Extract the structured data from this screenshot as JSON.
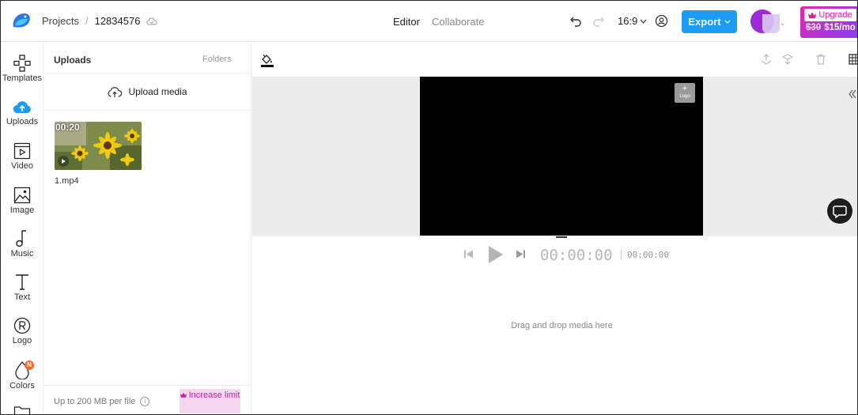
{
  "header": {
    "projects_label": "Projects",
    "project_id": "12834576",
    "tab_editor": "Editor",
    "tab_collaborate": "Collaborate",
    "aspect_ratio": "16:9",
    "export_label": "Export",
    "upgrade_label": "Upgrade",
    "old_price": "$30",
    "new_price": "$15/mo"
  },
  "sidebar": {
    "items": [
      {
        "label": "Templates",
        "icon": "templates-icon"
      },
      {
        "label": "Uploads",
        "icon": "upload-cloud-icon"
      },
      {
        "label": "Video",
        "icon": "video-icon"
      },
      {
        "label": "Image",
        "icon": "image-icon"
      },
      {
        "label": "Music",
        "icon": "music-note-icon"
      },
      {
        "label": "Text",
        "icon": "text-icon"
      },
      {
        "label": "Logo",
        "icon": "registered-icon"
      },
      {
        "label": "Colors",
        "icon": "color-drop-icon",
        "badge": "N"
      }
    ]
  },
  "uploads_panel": {
    "title": "Uploads",
    "folders_tab": "Folders",
    "upload_button": "Upload media",
    "media": [
      {
        "duration": "00:20",
        "filename": "1.mp4"
      }
    ],
    "limit_text": "Up to 200 MB per file",
    "increase_label": "Increase limit"
  },
  "canvas": {
    "logo_placeholder": "Logo"
  },
  "player": {
    "current_time": "00:00:00",
    "total_time": "00:00:00"
  },
  "timeline": {
    "drop_hint": "Drag and drop media here"
  },
  "colors": {
    "accent": "#1c9cf2",
    "upgrade_gradient_start": "#e02ab0",
    "upgrade_gradient_end": "#8a3df0",
    "increase_bg": "#f7d6f0"
  }
}
